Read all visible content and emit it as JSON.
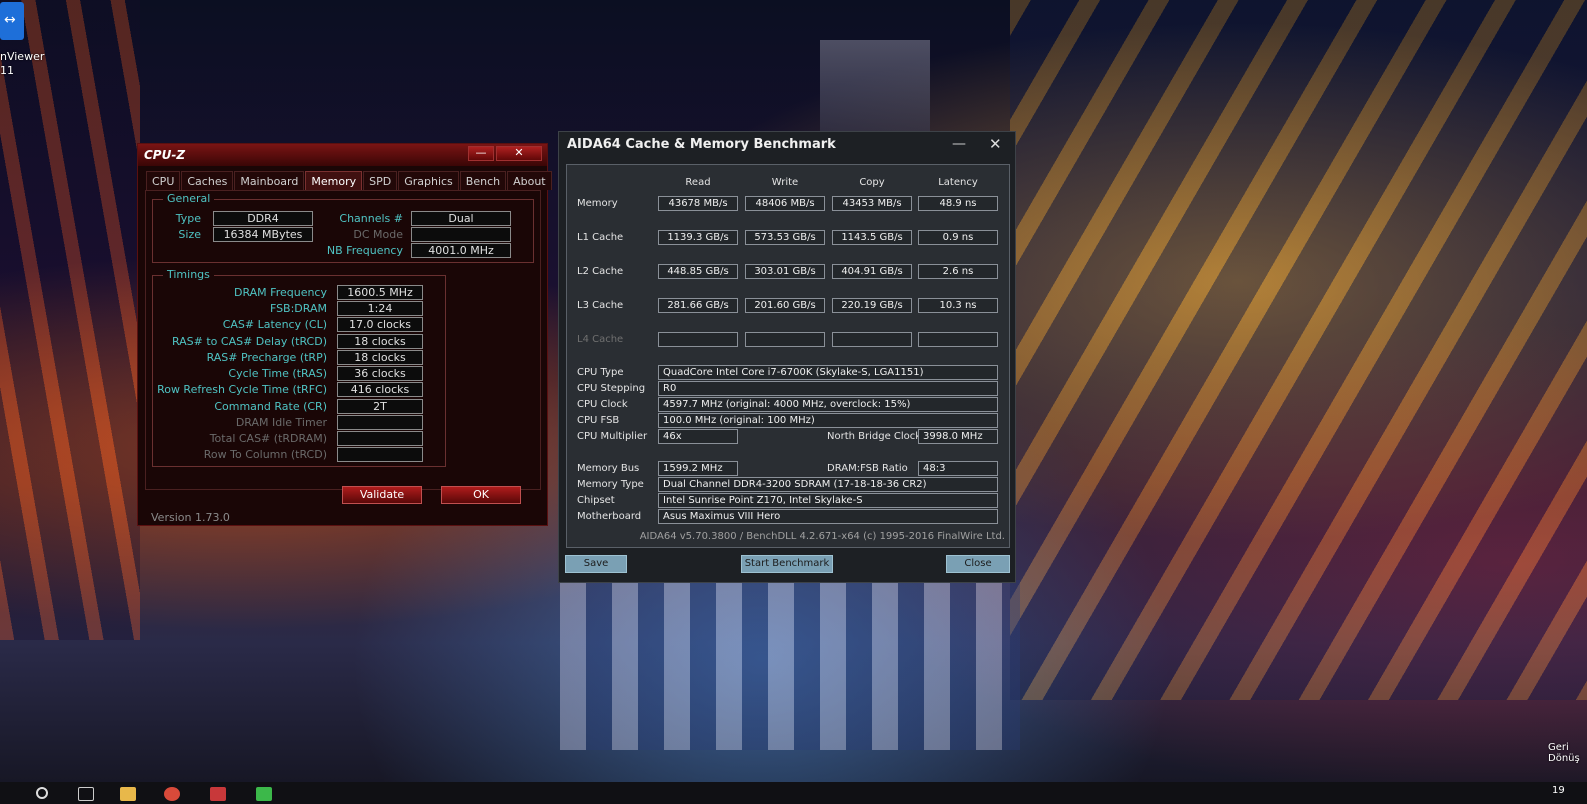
{
  "desktop": {
    "icon_label": "nViewer",
    "icon_sublabel": "11",
    "tray_line1": "Geri",
    "tray_line2": "Dönüş",
    "clock_partial": "19"
  },
  "cpuz": {
    "title": "CPU-Z",
    "min_glyph": "—",
    "close_glyph": "✕",
    "tabs": [
      "CPU",
      "Caches",
      "Mainboard",
      "Memory",
      "SPD",
      "Graphics",
      "Bench",
      "About"
    ],
    "active_tab": "Memory",
    "general": {
      "title": "General",
      "type_label": "Type",
      "type_value": "DDR4",
      "size_label": "Size",
      "size_value": "16384 MBytes",
      "channels_label": "Channels #",
      "channels_value": "Dual",
      "dcmode_label": "DC Mode",
      "dcmode_value": "",
      "nbfreq_label": "NB Frequency",
      "nbfreq_value": "4001.0 MHz"
    },
    "timings": {
      "title": "Timings",
      "rows": [
        {
          "label": "DRAM Frequency",
          "value": "1600.5 MHz"
        },
        {
          "label": "FSB:DRAM",
          "value": "1:24"
        },
        {
          "label": "CAS# Latency (CL)",
          "value": "17.0 clocks"
        },
        {
          "label": "RAS# to CAS# Delay (tRCD)",
          "value": "18 clocks"
        },
        {
          "label": "RAS# Precharge (tRP)",
          "value": "18 clocks"
        },
        {
          "label": "Cycle Time (tRAS)",
          "value": "36 clocks"
        },
        {
          "label": "Row Refresh Cycle Time (tRFC)",
          "value": "416 clocks"
        },
        {
          "label": "Command Rate (CR)",
          "value": "2T"
        },
        {
          "label": "DRAM Idle Timer",
          "value": ""
        },
        {
          "label": "Total CAS# (tRDRAM)",
          "value": ""
        },
        {
          "label": "Row To Column (tRCD)",
          "value": ""
        }
      ]
    },
    "validate_label": "Validate",
    "ok_label": "OK",
    "version": "Version 1.73.0"
  },
  "aida": {
    "title": "AIDA64 Cache & Memory Benchmark",
    "min_glyph": "—",
    "close_glyph": "✕",
    "headers": [
      "Read",
      "Write",
      "Copy",
      "Latency"
    ],
    "rows": [
      {
        "label": "Memory",
        "read": "43678 MB/s",
        "write": "48406 MB/s",
        "copy": "43453 MB/s",
        "latency": "48.9 ns"
      },
      {
        "label": "L1 Cache",
        "read": "1139.3 GB/s",
        "write": "573.53 GB/s",
        "copy": "1143.5 GB/s",
        "latency": "0.9 ns"
      },
      {
        "label": "L2 Cache",
        "read": "448.85 GB/s",
        "write": "303.01 GB/s",
        "copy": "404.91 GB/s",
        "latency": "2.6 ns"
      },
      {
        "label": "L3 Cache",
        "read": "281.66 GB/s",
        "write": "201.60 GB/s",
        "copy": "220.19 GB/s",
        "latency": "10.3 ns"
      },
      {
        "label": "L4 Cache",
        "read": "",
        "write": "",
        "copy": "",
        "latency": ""
      }
    ],
    "info": {
      "cpu_type_label": "CPU Type",
      "cpu_type": "QuadCore Intel Core i7-6700K  (Skylake-S, LGA1151)",
      "cpu_stepping_label": "CPU Stepping",
      "cpu_stepping": "R0",
      "cpu_clock_label": "CPU Clock",
      "cpu_clock": "4597.7 MHz  (original: 4000 MHz, overclock: 15%)",
      "cpu_fsb_label": "CPU FSB",
      "cpu_fsb": "100.0 MHz  (original: 100 MHz)",
      "cpu_mult_label": "CPU Multiplier",
      "cpu_mult": "46x",
      "nb_clock_label": "North Bridge Clock",
      "nb_clock": "3998.0 MHz",
      "mem_bus_label": "Memory Bus",
      "mem_bus": "1599.2 MHz",
      "dram_fsb_label": "DRAM:FSB Ratio",
      "dram_fsb": "48:3",
      "mem_type_label": "Memory Type",
      "mem_type": "Dual Channel DDR4-3200 SDRAM  (17-18-18-36 CR2)",
      "chipset_label": "Chipset",
      "chipset": "Intel Sunrise Point Z170, Intel Skylake-S",
      "motherboard_label": "Motherboard",
      "motherboard": "Asus Maximus VIII Hero"
    },
    "footer": "AIDA64 v5.70.3800 / BenchDLL 4.2.671-x64  (c) 1995-2016 FinalWire Ltd.",
    "save_label": "Save",
    "start_label": "Start Benchmark",
    "close_label": "Close"
  }
}
